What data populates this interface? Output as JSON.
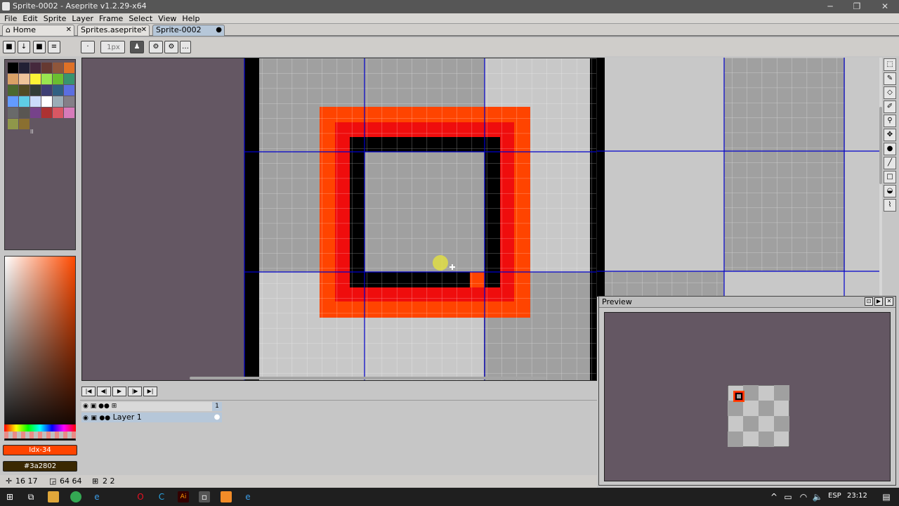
{
  "window": {
    "title": "Sprite-0002 - Aseprite v1.2.29-x64",
    "minimize": "─",
    "maximize": "❐",
    "close": "✕"
  },
  "menu": [
    "File",
    "Edit",
    "Sprite",
    "Layer",
    "Frame",
    "Select",
    "View",
    "Help"
  ],
  "tabs": [
    {
      "label": "Home",
      "icon": "home-icon",
      "close": "✕"
    },
    {
      "label": "Sprites.aseprite",
      "close": "✕"
    },
    {
      "label": "Sprite-0002",
      "close": "●"
    }
  ],
  "toolbar": {
    "brush_size_placeholder": "1px"
  },
  "palette": {
    "colors": [
      "#000000",
      "#222034",
      "#45283c",
      "#663931",
      "#8f563b",
      "#df7126",
      "#d9a066",
      "#eec39a",
      "#fbf236",
      "#99e550",
      "#6abe30",
      "#37946e",
      "#4b692f",
      "#524b24",
      "#323c39",
      "#3f3f74",
      "#306082",
      "#5b6ee1",
      "#639bff",
      "#5fcde4",
      "#cbdbfc",
      "#ffffff",
      "#9badb7",
      "#847e87",
      "#696a6a",
      "#595652",
      "#76428a",
      "#ac3232",
      "#d95763",
      "#d77bba",
      "#8f974a",
      "#8a6f30"
    ],
    "extra_label": "II"
  },
  "colors": {
    "foreground_label": "Idx-34",
    "foreground": "#ff4400",
    "background_label": "#3a2802",
    "background": "#3a2802"
  },
  "timeline": {
    "layer_name": "Layer 1",
    "frame_number": "1"
  },
  "preview": {
    "title": "Preview"
  },
  "status": {
    "position": "16 17",
    "size": "64 64",
    "grid": "2 2"
  },
  "taskbar": {
    "lang": "ESP",
    "time": "23:12"
  }
}
